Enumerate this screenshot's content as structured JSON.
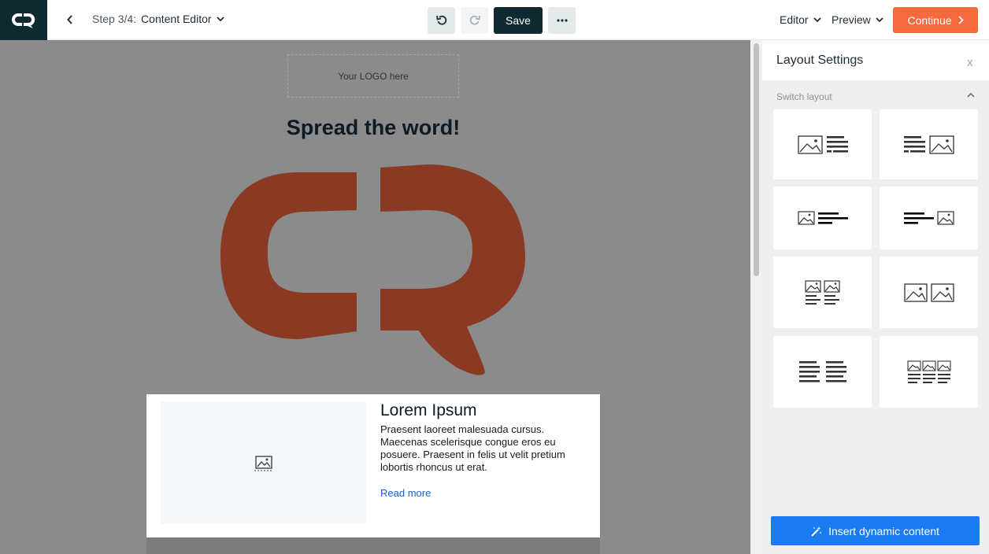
{
  "app": {
    "brand_icon": "cleverreach-logo-icon"
  },
  "header": {
    "back_icon": "chevron-left-icon",
    "step_prefix": "Step 3/4:",
    "step_title": "Content Editor",
    "undo_icon": "undo-icon",
    "redo_icon": "redo-icon",
    "save_label": "Save",
    "more_icon": "more-dots-icon",
    "editor_label": "Editor",
    "preview_label": "Preview",
    "continue_label": "Continue",
    "accent_color": "#f76a40",
    "dark_color": "#0e2a30"
  },
  "canvas": {
    "logo_placeholder": "Your LOGO here",
    "headline": "Spread the word!",
    "logo_color": "#8a3a22",
    "block": {
      "title": "Lorem Ipsum",
      "body": "Praesent laoreet malesuada cursus. Maecenas scelerisque congue eros eu posuere. Praesent in felis ut velit pretium lobortis rhoncus ut erat.",
      "link": "Read more"
    }
  },
  "panel": {
    "title": "Layout Settings",
    "close_label": "x",
    "section_label": "Switch layout",
    "layouts": [
      {
        "name": "image-left-text-right"
      },
      {
        "name": "text-left-image-right"
      },
      {
        "name": "small-image-left-text"
      },
      {
        "name": "text-small-image-right"
      },
      {
        "name": "two-images-with-text"
      },
      {
        "name": "two-images"
      },
      {
        "name": "two-text-columns"
      },
      {
        "name": "three-columns"
      }
    ],
    "insert_label": "Insert dynamic content",
    "insert_color": "#1a7cf0"
  }
}
